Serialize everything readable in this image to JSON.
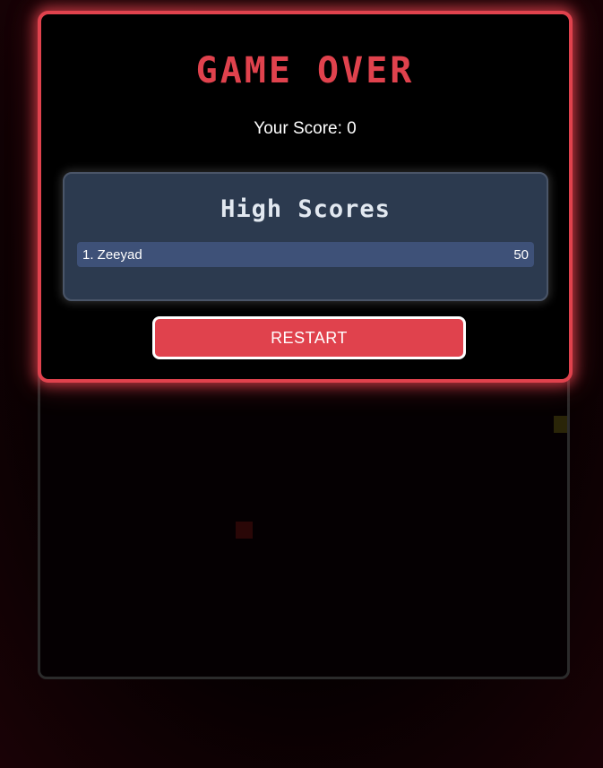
{
  "game_over": {
    "title": "GAME OVER",
    "score_label": "Your Score: 0",
    "restart_label": "RESTART"
  },
  "high_scores": {
    "title": "High Scores",
    "entries": [
      {
        "rank_name": "1. Zeeyad",
        "score": "50"
      }
    ]
  },
  "colors": {
    "accent": "#e0424d",
    "panel": "#2c3a4f",
    "row": "#3e5178"
  }
}
